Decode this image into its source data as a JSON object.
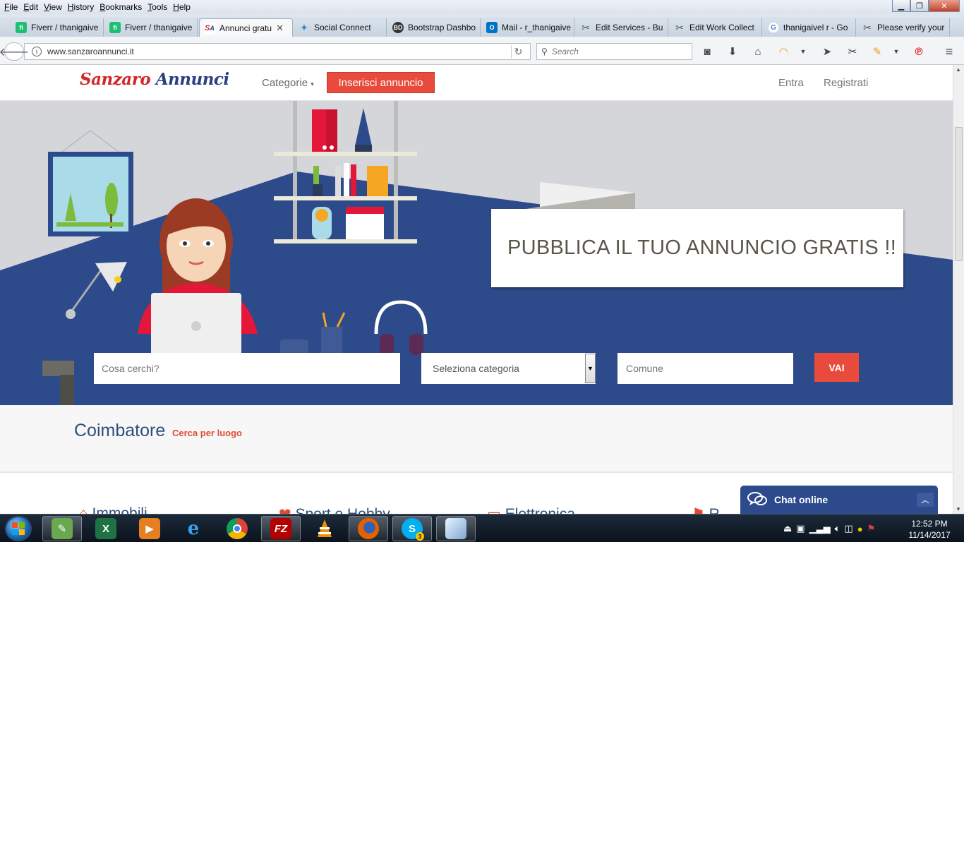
{
  "browser": {
    "menu": [
      "File",
      "Edit",
      "View",
      "History",
      "Bookmarks",
      "Tools",
      "Help"
    ],
    "tabs": [
      {
        "label": "Fiverr / thanigaive",
        "icon": "fiverr-icon",
        "color": "#1dbf73"
      },
      {
        "label": "Fiverr / thanigaive",
        "icon": "fiverr-icon",
        "color": "#1dbf73"
      },
      {
        "label": "Annunci gratu",
        "icon": "sanzaro-icon",
        "color": "#d3262a",
        "active": true
      },
      {
        "label": "Social Connect",
        "icon": "social-connect-icon",
        "color": "#2a8fd0"
      },
      {
        "label": "Bootstrap Dashbo",
        "icon": "bootstrap-dashboard-icon",
        "color": "#333333"
      },
      {
        "label": "Mail - r_thanigaive",
        "icon": "outlook-icon",
        "color": "#0072c6"
      },
      {
        "label": "Edit Services - Bu",
        "icon": "tools-icon",
        "color": "#555555"
      },
      {
        "label": "Edit Work Collect",
        "icon": "tools-icon",
        "color": "#555555"
      },
      {
        "label": "thanigaivel r - Go",
        "icon": "google-icon",
        "color": "#4285f4"
      },
      {
        "label": "Please verify your",
        "icon": "tools-icon",
        "color": "#555555"
      }
    ],
    "tab_close": "✕",
    "url": "www.sanzaroannunci.it",
    "search_placeholder": "Search"
  },
  "site": {
    "logo_part1": "Sanzaro",
    "logo_part2": "Annunci",
    "nav_categorie": "Categorie",
    "nav_inserisci": "Inserisci annuncio",
    "nav_entra": "Entra",
    "nav_registrati": "Registrati",
    "hero_banner": "PUBBLICA IL TUO ANNUNCIO GRATIS !!",
    "search_placeholder": "Cosa cerchi?",
    "category_select": "Seleziona categoria",
    "comune_placeholder": "Comune",
    "go_button": "VAI",
    "city": "Coimbatore",
    "city_link": "Cerca per luogo",
    "categories_partial": [
      "Immobili",
      "Sport e Hobby",
      "Elettronica",
      "R..."
    ],
    "chat_label": "Chat online",
    "colors": {
      "brand_red": "#e84b3c",
      "brand_blue": "#2c3f82",
      "hero_navy": "#2d4a8a"
    }
  },
  "taskbar": {
    "apps": [
      "gadget-app-icon",
      "excel-icon",
      "media-player-icon",
      "internet-explorer-icon",
      "chrome-icon",
      "filezilla-icon",
      "vlc-icon",
      "firefox-icon",
      "skype-icon",
      "notepad-icon"
    ],
    "skype_badge": "3",
    "time": "12:52 PM",
    "date": "11/14/2017"
  }
}
